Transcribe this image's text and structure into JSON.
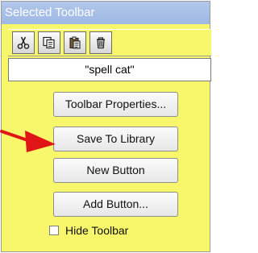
{
  "window": {
    "title": "Selected Toolbar"
  },
  "toolbar": {
    "buttons": [
      {
        "icon": "scissors-icon"
      },
      {
        "icon": "copy-icon"
      },
      {
        "icon": "paste-icon"
      },
      {
        "icon": "delete-icon"
      }
    ]
  },
  "field": {
    "value": "\"spell cat\""
  },
  "buttons": {
    "toolbar_properties": "Toolbar Properties...",
    "save_to_library": "Save To Library",
    "new_button": "New Button",
    "add_button": "Add Button..."
  },
  "checkbox": {
    "label": "Hide Toolbar",
    "checked": false
  },
  "colors": {
    "panel_background": "#f8f66a",
    "title_bar": "#a9c0e8",
    "arrow": "#e01616"
  }
}
